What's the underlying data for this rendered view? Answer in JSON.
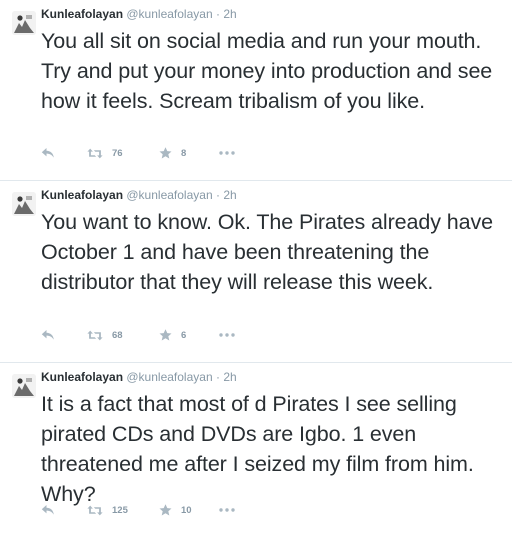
{
  "colors": {
    "text": "#292f33",
    "muted": "#8899a6",
    "icon": "#aab8c2",
    "divider": "#e1e8ed"
  },
  "tweets": [
    {
      "name": "Kunleafolayan",
      "handle": "@kunleafolayan",
      "separator": "·",
      "time": "2h",
      "text": "You all sit on social media and run your mouth. Try and put your money into production and see how it feels. Scream tribalism of you like.",
      "retweets": "76",
      "favorites": "8"
    },
    {
      "name": "Kunleafolayan",
      "handle": "@kunleafolayan",
      "separator": "·",
      "time": "2h",
      "text": "You want to know. Ok. The Pirates already have October 1 and have been threatening the distributor that they will release this week.",
      "retweets": "68",
      "favorites": "6"
    },
    {
      "name": "Kunleafolayan",
      "handle": "@kunleafolayan",
      "separator": "·",
      "time": "2h",
      "text": "It is a fact that most of d Pirates I see selling pirated CDs and DVDs are Igbo. 1 even threatened me after I seized my film from him. Why?",
      "retweets": "125",
      "favorites": "10"
    }
  ],
  "icons": {
    "reply": "reply-icon",
    "retweet": "retweet-icon",
    "favorite": "star-icon",
    "more": "more-options-icon"
  }
}
